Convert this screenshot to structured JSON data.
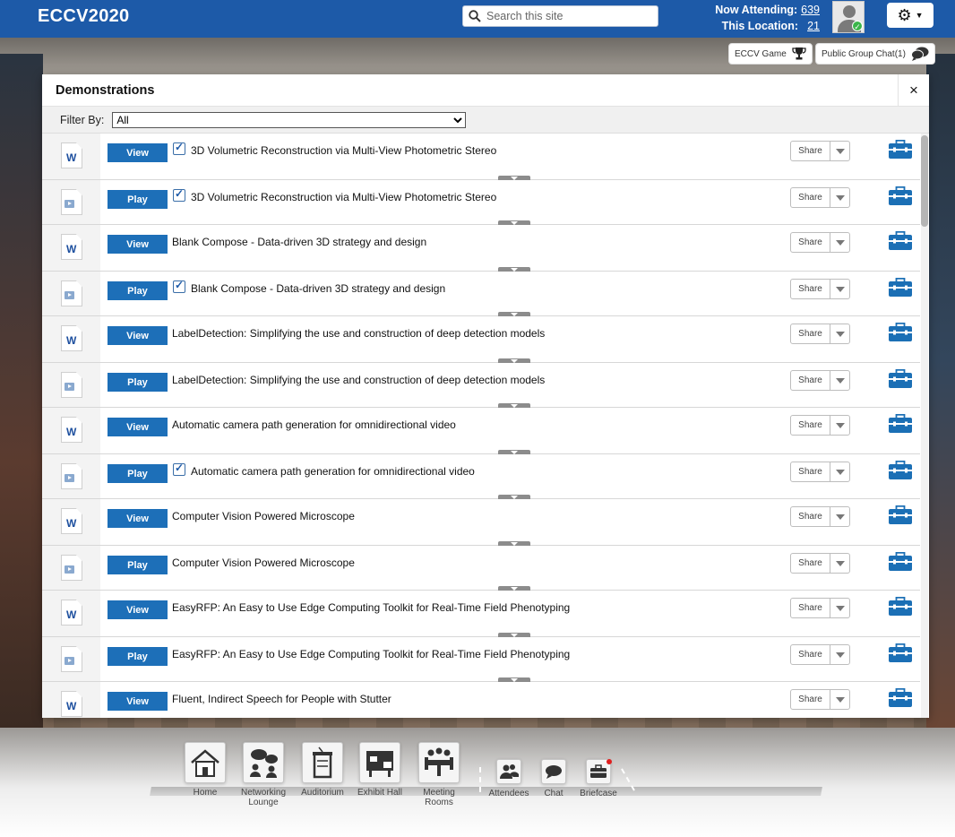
{
  "app": {
    "brand": "ECCV2020"
  },
  "search": {
    "placeholder": "Search this site"
  },
  "stats": {
    "now_attending_label": "Now Attending:",
    "now_attending_value": "639",
    "this_location_label": "This Location:",
    "this_location_value": "21"
  },
  "top_actions": {
    "game_label": "ECCV Game",
    "chat_label": "Public Group Chat(1)"
  },
  "modal": {
    "title": "Demonstrations",
    "close_label": "×",
    "filter_label": "Filter By:",
    "filter_value": "All"
  },
  "share_label": "Share",
  "rows": [
    {
      "type": "doc",
      "button": "View",
      "checked": true,
      "title": "3D Volumetric Reconstruction via Multi-View Photometric Stereo"
    },
    {
      "type": "video",
      "button": "Play",
      "checked": true,
      "title": "3D Volumetric Reconstruction via Multi-View Photometric Stereo"
    },
    {
      "type": "doc",
      "button": "View",
      "checked": false,
      "title": "Blank Compose - Data-driven 3D strategy and design"
    },
    {
      "type": "video",
      "button": "Play",
      "checked": true,
      "title": "Blank Compose - Data-driven 3D strategy and design"
    },
    {
      "type": "doc",
      "button": "View",
      "checked": false,
      "title": "LabelDetection: Simplifying the use and construction of deep detection models"
    },
    {
      "type": "video",
      "button": "Play",
      "checked": false,
      "title": "LabelDetection: Simplifying the use and construction of deep detection models"
    },
    {
      "type": "doc",
      "button": "View",
      "checked": false,
      "title": "Automatic camera path generation for omnidirectional video"
    },
    {
      "type": "video",
      "button": "Play",
      "checked": true,
      "title": "Automatic camera path generation for omnidirectional video"
    },
    {
      "type": "doc",
      "button": "View",
      "checked": false,
      "title": "Computer Vision Powered Microscope"
    },
    {
      "type": "video",
      "button": "Play",
      "checked": false,
      "title": "Computer Vision Powered Microscope"
    },
    {
      "type": "doc",
      "button": "View",
      "checked": false,
      "title": "EasyRFP: An Easy to Use Edge Computing Toolkit for Real-Time Field Phenotyping"
    },
    {
      "type": "video",
      "button": "Play",
      "checked": false,
      "title": "EasyRFP: An Easy to Use Edge Computing Toolkit for Real-Time Field Phenotyping"
    },
    {
      "type": "doc",
      "button": "View",
      "checked": false,
      "title": "Fluent, Indirect Speech for People with Stutter"
    }
  ],
  "bottom_nav": {
    "home": "Home",
    "networking_1": "Networking",
    "networking_2": "Lounge",
    "auditorium": "Auditorium",
    "exhibit": "Exhibit Hall",
    "meeting_1": "Meeting",
    "meeting_2": "Rooms",
    "attendees": "Attendees",
    "chat": "Chat",
    "briefcase": "Briefcase"
  },
  "colors": {
    "header": "#1d5aa8",
    "button": "#1d6fb8",
    "icon_blue": "#1b6fb5"
  }
}
